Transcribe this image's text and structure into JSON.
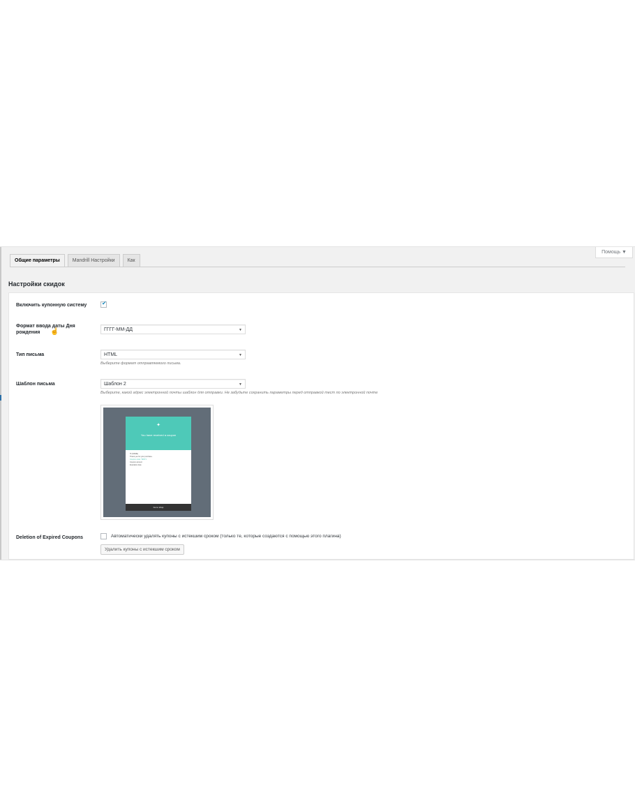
{
  "help": {
    "label": "Помощь ▼"
  },
  "tabs": [
    {
      "label": "Общие параметры",
      "active": true
    },
    {
      "label": "Mandrill Настройки",
      "active": false
    },
    {
      "label": "Как",
      "active": false
    }
  ],
  "section": {
    "title": "Настройки скидок"
  },
  "fields": {
    "enable_coupons": {
      "label": "Включить купонную систему",
      "checked": true
    },
    "birthday_format": {
      "label": "Формат ввода даты Дня рождения",
      "value": "ГГГГ-ММ-ДД"
    },
    "mail_type": {
      "label": "Тип письма",
      "value": "HTML",
      "description": "Выберите формат отправляемого письма."
    },
    "mail_template": {
      "label": "Шаблон письма",
      "value": "Шаблон 2",
      "description": "Выберите, какой адрес электронной почты шаблон для отправки. Не забудьте сохранить параметры перед отправкой тест по электронной почте"
    },
    "deletion": {
      "label": "Deletion of Expired Coupons",
      "checkbox_label": "Автоматически удалять купоны с истекшим сроком (только те, которые создаются с помощью этого плагина)",
      "checked": false,
      "button_label": "Удалить купоны с истекшим сроком"
    }
  },
  "email_preview": {
    "heading": "You have received a coupon",
    "body_lines": [
      "Hi {NAME}",
      "Thank you for your purchase.",
      "Coupon code: TEST1",
      "Coupon amount",
      "Expiration date"
    ],
    "footer": "Go to shop"
  },
  "colors": {
    "accent": "#4ec9b8",
    "checkbox": "#1e8cbe"
  }
}
